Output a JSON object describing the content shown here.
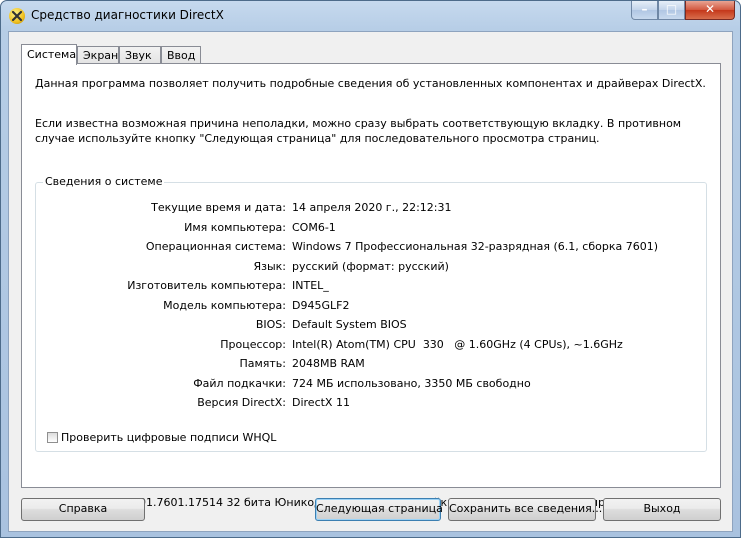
{
  "window": {
    "title": "Средство диагностики DirectX",
    "min_glyph": "–",
    "max_glyph": "□",
    "close_glyph": "✕"
  },
  "tabs": [
    {
      "label": "Система",
      "active": true
    },
    {
      "label": "Экран",
      "active": false
    },
    {
      "label": "Звук",
      "active": false
    },
    {
      "label": "Ввод",
      "active": false
    }
  ],
  "intro": {
    "line1": "Данная программа позволяет получить подробные сведения об установленных компонентах и драйверах DirectX.",
    "line2": "Если известна возможная причина неполадки, можно сразу выбрать соответствующую вкладку. В противном случае используйте кнопку \"Следующая страница\" для последовательного просмотра страниц."
  },
  "system_info": {
    "title": "Сведения о системе",
    "rows": [
      {
        "label": "Текущие время и дата:",
        "value": "14 апреля 2020 г., 22:12:31"
      },
      {
        "label": "Имя компьютера:",
        "value": "COM6-1"
      },
      {
        "label": "Операционная система:",
        "value": "Windows 7 Профессиональная 32-разрядная (6.1, сборка 7601)"
      },
      {
        "label": "Язык:",
        "value": "русский (формат: русский)"
      },
      {
        "label": "Изготовитель компьютера:",
        "value": "INTEL_"
      },
      {
        "label": "Модель компьютера:",
        "value": "D945GLF2"
      },
      {
        "label": "BIOS:",
        "value": "Default System BIOS"
      },
      {
        "label": "Процессор:",
        "value": "Intel(R) Atom(TM) CPU  330   @ 1.60GHz (4 CPUs), ~1.6GHz"
      },
      {
        "label": "Память:",
        "value": "2048MB RAM"
      },
      {
        "label": "Файл подкачки:",
        "value": "724 МБ использовано, 3350 МБ свободно"
      },
      {
        "label": "Версия DirectX:",
        "value": "DirectX 11"
      }
    ],
    "whql_checkbox": {
      "label": "Проверить цифровые подписи WHQL",
      "checked": false
    }
  },
  "footer_text": "DxDiag 6.01.7601.17514 32 бита Юникод  © Корпорация Майкрософт, 1998-2006.  Все права защищены.",
  "buttons": {
    "help": "Справка",
    "next_page": "Следующая страница",
    "save_all": "Сохранить все сведения...",
    "exit": "Выход"
  },
  "colors": {
    "titlebar": "#b6cde6",
    "close_button": "#c4371a",
    "client_bg": "#f0f0f0"
  }
}
